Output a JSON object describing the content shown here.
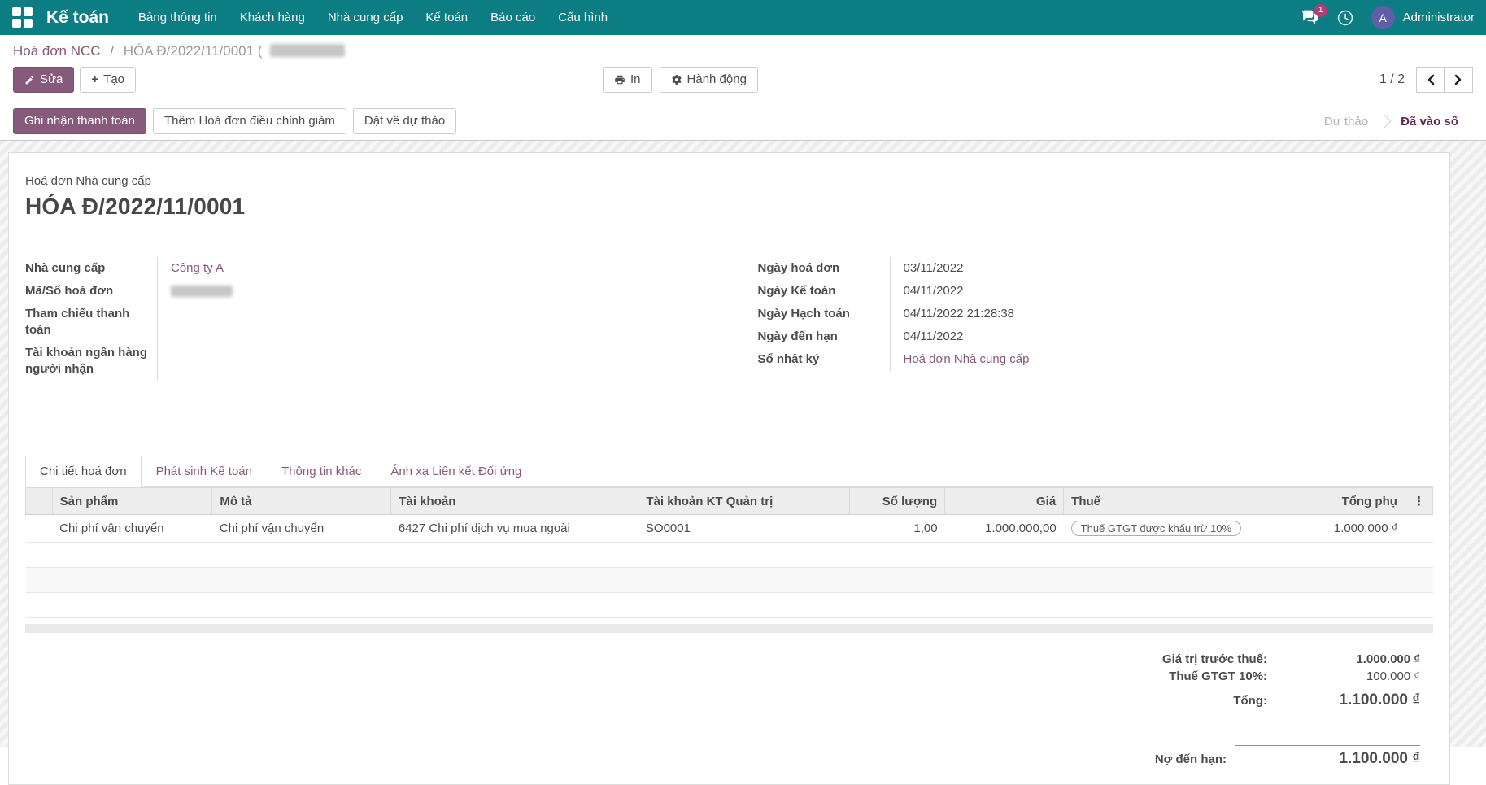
{
  "navbar": {
    "brand": "Kế toán",
    "menus": [
      "Bảng thông tin",
      "Khách hàng",
      "Nhà cung cấp",
      "Kế toán",
      "Báo cáo",
      "Cấu hình"
    ],
    "messages_badge": "1",
    "user_initial": "A",
    "user_name": "Administrator"
  },
  "breadcrumb": {
    "parent": "Hoá đơn NCC",
    "separator": "/",
    "current": "HÓA Đ/2022/11/0001 ("
  },
  "actions": {
    "edit": "Sửa",
    "create": "Tạo",
    "print": "In",
    "action_menu": "Hành động",
    "pager": "1 / 2"
  },
  "statusbar": {
    "buttons": [
      "Ghi nhận thanh toán",
      "Thêm Hoá đơn điều chỉnh giảm",
      "Đặt về dự thảo"
    ],
    "state_draft": "Dự thảo",
    "state_posted": "Đã vào sổ"
  },
  "invoice": {
    "type_label": "Hoá đơn Nhà cung cấp",
    "name": "HÓA Đ/2022/11/0001",
    "left_fields": {
      "supplier_label": "Nhà cung cấp",
      "supplier_value": "Công ty A",
      "ref_label": "Mã/Số hoá đơn",
      "payment_ref_label": "Tham chiếu thanh toán",
      "bank_label": "Tài khoản ngân hàng người nhận"
    },
    "right_fields": {
      "invoice_date_label": "Ngày hoá đơn",
      "invoice_date": "03/11/2022",
      "accounting_date_label": "Ngày Kế toán",
      "accounting_date": "04/11/2022",
      "posting_date_label": "Ngày Hạch toán",
      "posting_date": "04/11/2022 21:28:38",
      "due_date_label": "Ngày đến hạn",
      "due_date": "04/11/2022",
      "journal_label": "Sổ nhật ký",
      "journal_value": "Hoá đơn Nhà cung cấp"
    },
    "tabs": [
      "Chi tiết hoá đơn",
      "Phát sinh Kế toán",
      "Thông tin khác",
      "Ánh xạ Liên kết Đối ứng"
    ],
    "lines_table": {
      "headers": [
        "Sản phẩm",
        "Mô tả",
        "Tài khoản",
        "Tài khoản KT Quản trị",
        "Số lượng",
        "Giá",
        "Thuế",
        "Tổng phụ"
      ],
      "rows": [
        {
          "product": "Chi phí vận chuyển",
          "description": "Chi phí vận chuyển",
          "account": "6427 Chi phí dịch vụ mua ngoài",
          "analytic_account": "SO0001",
          "quantity": "1,00",
          "price": "1.000.000,00",
          "tax": "Thuế GTGT được khấu trừ 10%",
          "subtotal": "1.000.000 ₫"
        }
      ]
    },
    "totals": {
      "untaxed_label": "Giá trị trước thuế:",
      "untaxed_value": "1.000.000 ₫",
      "tax_label": "Thuế GTGT 10%:",
      "tax_value": "100.000 ₫",
      "total_label": "Tổng:",
      "total_value": "1.100.000 ₫",
      "amount_due_label": "Nợ đến hạn:",
      "amount_due_value": "1.100.000 ₫"
    }
  },
  "icons": {
    "kebab": "⋮"
  },
  "colors": {
    "navbar": "#0d7d84",
    "accent": "#875a7b",
    "badge": "#b23d77",
    "avatar": "#615ea8"
  }
}
